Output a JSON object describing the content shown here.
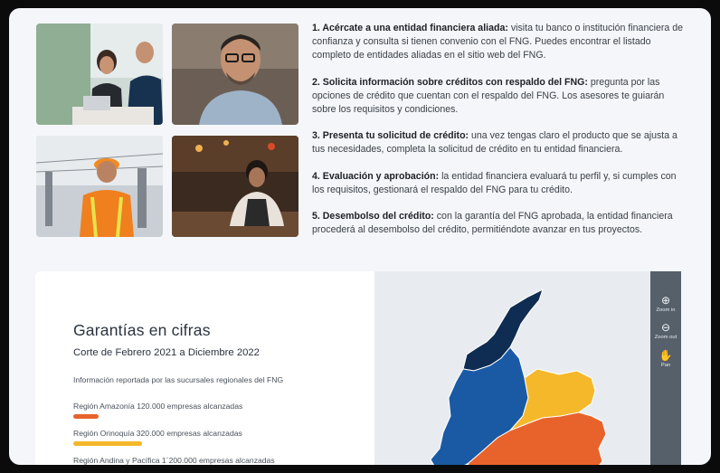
{
  "steps": [
    {
      "title": "1. Acércate a una entidad financiera aliada:",
      "text": " visita tu banco o institución financiera de confianza y consulta si tienen convenio con el FNG. Puedes encontrar el listado completo de entidades aliadas en el sitio web del FNG."
    },
    {
      "title": "2. Solicita información sobre créditos con respaldo del FNG:",
      "text": " pregunta por las opciones de crédito que cuentan con el respaldo del FNG. Los asesores te guiarán sobre los requisitos y condiciones."
    },
    {
      "title": "3. Presenta tu solicitud de crédito:",
      "text": " una vez tengas claro el producto que se ajusta a tus necesidades, completa la solicitud de crédito en tu entidad financiera."
    },
    {
      "title": "4. Evaluación y aprobación:",
      "text": " la entidad financiera evaluará tu perfil y, si cumples con los requisitos, gestionará el respaldo del FNG para tu crédito."
    },
    {
      "title": "5. Desembolso del crédito:",
      "text": " con la garantía del FNG aprobada, la entidad financiera procederá al desembolso del crédito, permitiéndote avanzar en tus proyectos."
    }
  ],
  "garantias": {
    "title": "Garantías en cifras",
    "subtitle": "Corte de Febrero 2021 a Diciembre 2022",
    "note": "Información reportada por las sucursales regionales del FNG",
    "regions": [
      {
        "label": "Región Amazonía 120.000 empresas alcanzadas",
        "color": "#e8632b",
        "fraction": 0.1
      },
      {
        "label": "Región Orinoquía 320.000 empresas alcanzadas",
        "color": "#f5b82a",
        "fraction": 0.27
      },
      {
        "label": "Región Andina y Pacífica 1´200.000 empresas alcanzadas",
        "color": "#1a5aa5",
        "fraction": 1.0
      }
    ]
  },
  "map_tools": {
    "zoom_in": "Zoom in",
    "zoom_out": "Zoom out",
    "pan": "Pan"
  },
  "colors": {
    "navy": "#0f2c52",
    "blue": "#1a5aa5",
    "yellow": "#f5b82a",
    "orange": "#e8632b"
  }
}
